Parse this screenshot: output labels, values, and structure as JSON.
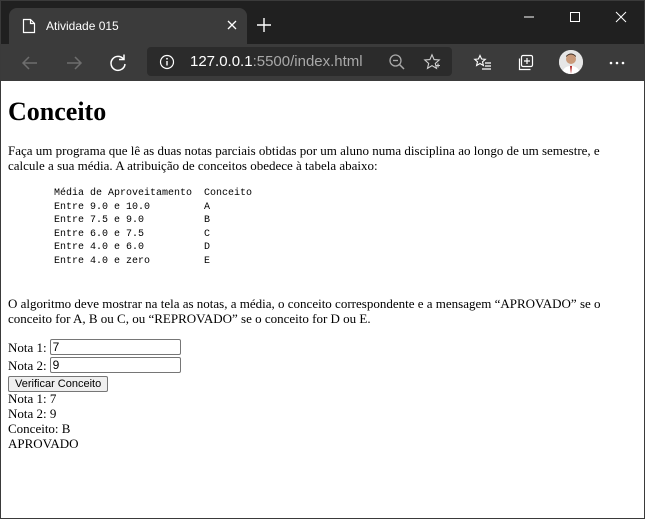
{
  "browser": {
    "tab": {
      "title": "Atividade 015"
    },
    "address": {
      "host": "127.0.0.1",
      "rest": ":5500/index.html"
    }
  },
  "page": {
    "heading": "Conceito",
    "intro": "Faça um programa que lê as duas notas parciais obtidas por um aluno numa disciplina ao longo de um semestre, e calcule a sua média. A atribuição de conceitos obedece à tabela abaixo:",
    "table_lines": [
      "Média de Aproveitamento  Conceito",
      "Entre 9.0 e 10.0         A",
      "Entre 7.5 e 9.0          B",
      "Entre 6.0 e 7.5          C",
      "Entre 4.0 e 6.0          D",
      "Entre 4.0 e zero         E"
    ],
    "instructions": "O algoritmo deve mostrar na tela as notas, a média, o conceito correspondente e a mensagem “APROVADO” se o conceito for A, B ou C, ou “REPROVADO” se o conceito for D ou E.",
    "form": {
      "nota1_label": "Nota 1:",
      "nota1_value": "7",
      "nota2_label": "Nota 2:",
      "nota2_value": "9",
      "button_label": "Verificar Conceito"
    },
    "result": {
      "line1": "Nota 1: 7",
      "line2": "Nota 2: 9",
      "line3": "Conceito: B",
      "line4": "APROVADO"
    }
  }
}
